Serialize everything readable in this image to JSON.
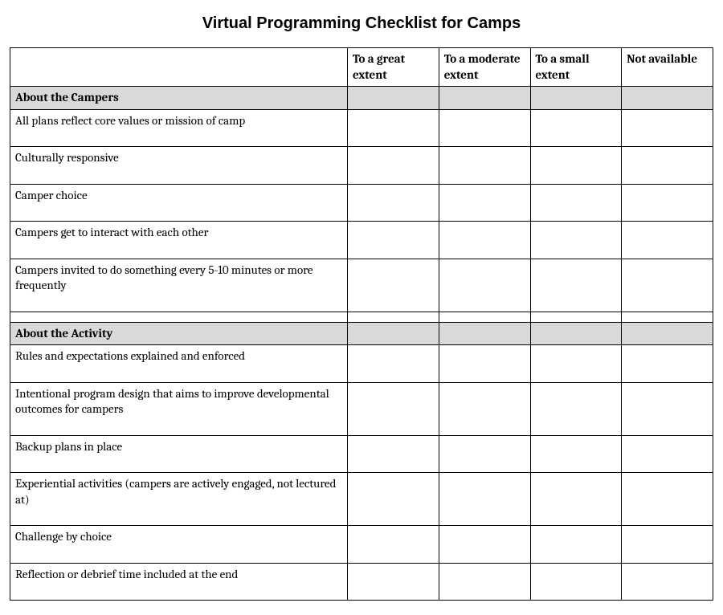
{
  "title": "Virtual Programming Checklist for Camps",
  "headers": {
    "col1": "To a great extent",
    "col2": "To a moderate extent",
    "col3": "To a small extent",
    "col4": "Not available"
  },
  "section1": {
    "heading": "About the Campers",
    "items": [
      "All plans reflect core values or mission of camp",
      "Culturally responsive",
      "Camper choice",
      "Campers get to interact with each other",
      "Campers invited to do something every 5-10 minutes or more frequently"
    ]
  },
  "section2": {
    "heading": "About the Activity",
    "items": [
      "Rules and expectations explained and enforced",
      "Intentional program design that aims to improve developmental outcomes for campers",
      "Backup plans in place",
      "Experiential activities (campers are actively engaged, not lectured at)",
      "Challenge by choice",
      "Reflection or debrief time included at the end"
    ]
  }
}
